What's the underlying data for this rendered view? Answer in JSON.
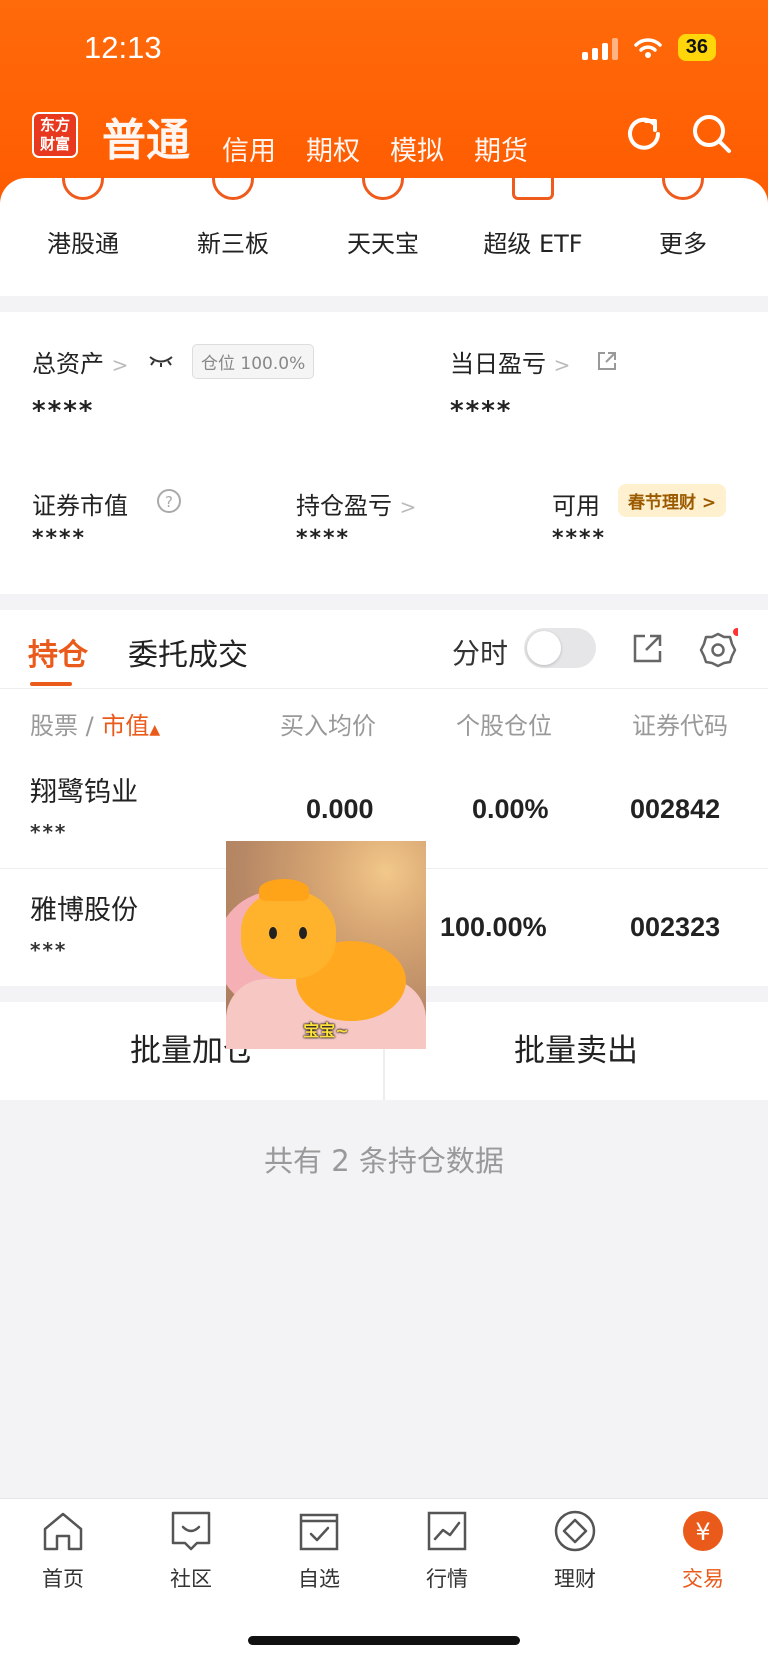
{
  "status_bar": {
    "time": "12:13",
    "battery": "36"
  },
  "header": {
    "logo_text": "东方\n财富",
    "tabs": [
      "普通",
      "信用",
      "期权",
      "模拟",
      "期货"
    ]
  },
  "shortcuts": [
    {
      "label": "港股通",
      "icon": "hk-icon",
      "glyph": "HK"
    },
    {
      "label": "新三板",
      "icon": "new-icon",
      "glyph": "新"
    },
    {
      "label": "天天宝",
      "icon": "piggy-bank-icon",
      "glyph": ""
    },
    {
      "label": "超级 ETF",
      "icon": "etf-icon",
      "glyph": "ETF"
    },
    {
      "label": "更多",
      "icon": "more-icon",
      "glyph": "···"
    }
  ],
  "assets": {
    "total_label": "总资产",
    "position_pill": "仓位 100.0%",
    "total_value": "****",
    "daily_pl_label": "当日盈亏",
    "daily_pl_value": "****",
    "market_value_label": "证券市值",
    "market_value": "****",
    "holding_pl_label": "持仓盈亏",
    "holding_pl_value": "****",
    "available_label": "可用",
    "available_value": "****",
    "promo": "春节理财"
  },
  "holdings": {
    "tabs": [
      "持仓",
      "委托成交"
    ],
    "timeshare_label": "分时",
    "timeshare_on": false,
    "col_stock": "股票",
    "col_market_value": "市值",
    "col_avg_price": "买入均价",
    "col_position": "个股仓位",
    "col_code": "证券代码",
    "rows": [
      {
        "name": "翔鹭钨业",
        "mask": "***",
        "avg_price": "0.000",
        "position": "0.00%",
        "code": "002842"
      },
      {
        "name": "雅博股份",
        "mask": "***",
        "avg_price": "",
        "position": "100.00%",
        "code": "002323"
      }
    ],
    "batch_add": "批量加仓",
    "batch_sell": "批量卖出",
    "summary": "共有 2 条持仓数据"
  },
  "sticker": {
    "caption": "宝宝~"
  },
  "tabbar": [
    {
      "label": "首页",
      "icon": "home-icon"
    },
    {
      "label": "社区",
      "icon": "community-icon"
    },
    {
      "label": "自选",
      "icon": "watchlist-icon"
    },
    {
      "label": "行情",
      "icon": "market-icon"
    },
    {
      "label": "理财",
      "icon": "wealth-icon"
    },
    {
      "label": "交易",
      "icon": "trade-icon",
      "active": true
    }
  ],
  "colors": {
    "brand": "#ff5a00",
    "accent": "#ea5a1a",
    "promo_bg": "#fff1cf"
  }
}
